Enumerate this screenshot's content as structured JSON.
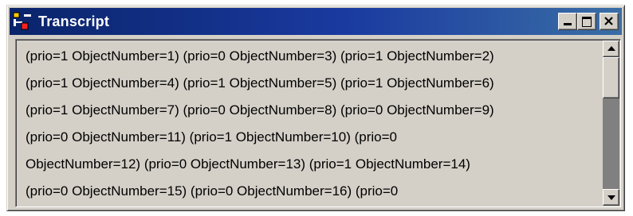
{
  "window": {
    "title": "Transcript",
    "icon": "transcript-app-icon",
    "controls": {
      "minimize_icon": "minimize-icon",
      "maximize_icon": "maximize-icon",
      "close_icon": "close-icon",
      "close_glyph": "✕"
    }
  },
  "transcript": {
    "lines": [
      "(prio=1 ObjectNumber=1) (prio=0 ObjectNumber=3) (prio=1 ObjectNumber=2)",
      "(prio=1 ObjectNumber=4) (prio=1 ObjectNumber=5) (prio=1 ObjectNumber=6)",
      "(prio=1 ObjectNumber=7) (prio=0 ObjectNumber=8) (prio=0 ObjectNumber=9)",
      "(prio=0 ObjectNumber=11) (prio=1 ObjectNumber=10) (prio=0",
      "ObjectNumber=12) (prio=0 ObjectNumber=13) (prio=1 ObjectNumber=14)",
      "(prio=0 ObjectNumber=15) (prio=0 ObjectNumber=16) (prio=0"
    ]
  },
  "colors": {
    "titlebar_start": "#0a246a",
    "titlebar_end": "#3a6ea5",
    "face": "#d4d0c8",
    "scroll_track": "#808080"
  }
}
